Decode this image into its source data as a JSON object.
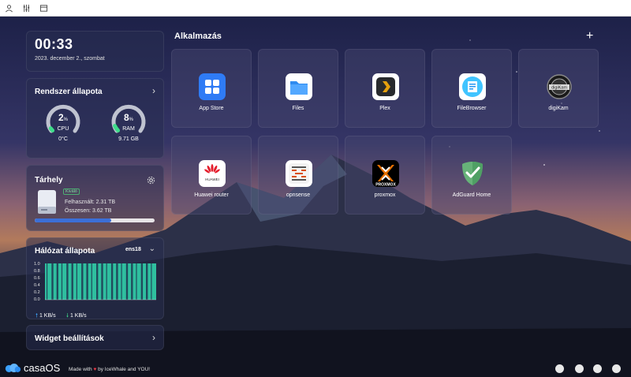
{
  "topbar": {
    "icons": [
      "user-icon",
      "sliders-icon",
      "window-icon"
    ]
  },
  "clock": {
    "time": "00:33",
    "date": "2023. december 2., szombat"
  },
  "system": {
    "title": "Rendszer állapota",
    "cpu": {
      "value": "2",
      "unit": "%",
      "label": "CPU",
      "sub": "0°C",
      "fraction": 0.02
    },
    "ram": {
      "value": "8",
      "unit": "%",
      "label": "RAM",
      "sub": "9.71 GB",
      "fraction": 0.08
    }
  },
  "storage": {
    "title": "Tárhely",
    "badge": "Kiváló",
    "used": "Felhasznált: 2.31 TB",
    "total": "Összesen: 3.62 TB",
    "fraction": 0.64
  },
  "network": {
    "title": "Hálózat állapota",
    "iface": "ens18",
    "yticks": [
      "1.0",
      "0.8",
      "0.6",
      "0.4",
      "0.2",
      "0.0"
    ],
    "upload": "1 KB/s",
    "download": "1 KB/s"
  },
  "widget_settings": {
    "label": "Widget beállítások"
  },
  "apps": {
    "title": "Alkalmazás",
    "items": [
      {
        "name": "App Store",
        "icon": "appstore-icon"
      },
      {
        "name": "Files",
        "icon": "files-icon"
      },
      {
        "name": "Plex",
        "icon": "plex-icon"
      },
      {
        "name": "FileBrowser",
        "icon": "filebrowser-icon"
      },
      {
        "name": "digiKam",
        "icon": "digikam-icon"
      },
      {
        "name": "Huawei router",
        "icon": "huawei-icon"
      },
      {
        "name": "opnsense",
        "icon": "opnsense-icon"
      },
      {
        "name": "proxmox",
        "icon": "proxmox-icon"
      },
      {
        "name": "AdGuard Home",
        "icon": "adguard-icon"
      }
    ]
  },
  "footer": {
    "logo": "casaOS",
    "made_pre": "Made with",
    "made_post": "by IceWhale and YOU!",
    "social": [
      "message-icon",
      "discord-icon",
      "github-icon",
      "reddit-icon"
    ]
  },
  "colors": {
    "accent_green": "#3edc8a",
    "bar_blue": "#3b6fd8",
    "chart_fill": "#2fbf9f"
  }
}
